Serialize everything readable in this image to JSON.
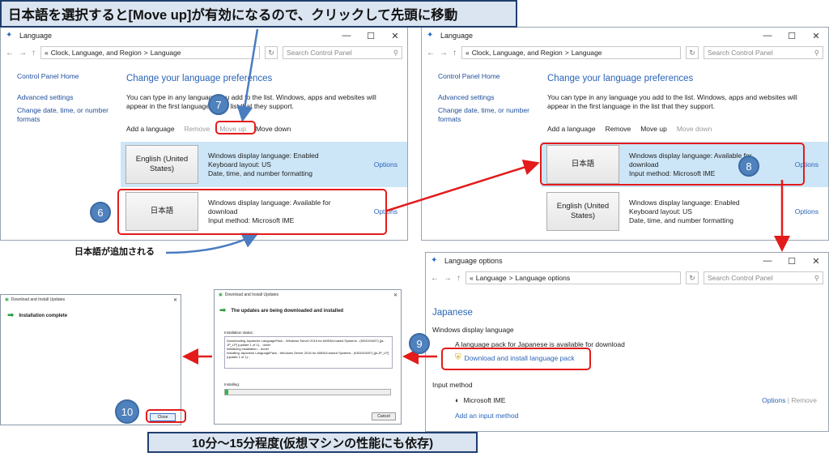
{
  "captions": {
    "top": "日本語を選択すると[Move up]が有効になるので、クリックして先頭に移動",
    "bottom": "10分～15分程度(仮想マシンの性能にも依存)",
    "added": "日本語が追加される"
  },
  "badges": [
    "6",
    "7",
    "8",
    "9",
    "10"
  ],
  "language_window": {
    "title": "Language",
    "controls": [
      "—",
      "☐",
      "✕"
    ],
    "nav": {
      "back": "←",
      "forward": "→",
      "up": "↑"
    },
    "address": [
      "«",
      "Clock, Language, and Region",
      ">",
      "Language"
    ],
    "search_placeholder": "Search Control Panel",
    "sidebar": {
      "home": "Control Panel Home",
      "advanced": "Advanced settings",
      "change_date": "Change date, time, or number formats"
    },
    "heading": "Change your language preferences",
    "description": "You can type in any language you add to the list. Windows, apps and websites will appear in the first language in the list that they support.",
    "toolbar": {
      "add": "Add a language",
      "remove": "Remove",
      "move_up": "Move up",
      "move_down": "Move down"
    },
    "english": {
      "name": "English (United States)",
      "line1": "Windows display language: Enabled",
      "line2": "Keyboard layout: US",
      "line3": "Date, time, and number formatting",
      "options": "Options"
    },
    "japanese": {
      "name": "日本語",
      "line1": "Windows display language: Available for download",
      "line2": "Input method: Microsoft IME",
      "options": "Options"
    }
  },
  "options_window": {
    "title": "Language options",
    "address": [
      "«",
      "Language",
      ">",
      "Language options"
    ],
    "search_placeholder": "Search Control Panel",
    "heading": "Japanese",
    "display_section": "Windows display language",
    "pack_available": "A language pack for Japanese is available for download",
    "download_link": "Download and install language pack",
    "input_section": "Input method",
    "ime": "Microsoft IME",
    "ime_options": "Options",
    "ime_remove": "Remove",
    "add_input": "Add an input method"
  },
  "progress_dialog": {
    "title": "Download and Install Updates",
    "header": "The updates are being downloaded and installed",
    "status_label": "Installation status:",
    "log": "Downloading Japanese LanguagePack - Windows Server 2016 for AMD64-based Systems - (KB3193497) [ja-JP_LP] (update 1 of 1)... done!\nInitializing installation... done!\nInstalling Japanese LanguagePack - Windows Server 2016 for AMD64-based Systems - (KB3193497) [ja-JP_LP] (update 1 of 1)...",
    "installing_label": "Installing:",
    "progress": 0.02,
    "cancel": "Cancel"
  },
  "complete_dialog": {
    "title": "Download and Install Updates",
    "header": "Installation complete",
    "close": "Close"
  },
  "colors": {
    "annotation_red": "#e31b1b",
    "badge_blue": "#4f81bd",
    "caption_bg": "#dbe5f1",
    "link_blue": "#2a64b8",
    "selected_row": "#cde6f7",
    "arrow_blue": "#4a7cc0"
  }
}
